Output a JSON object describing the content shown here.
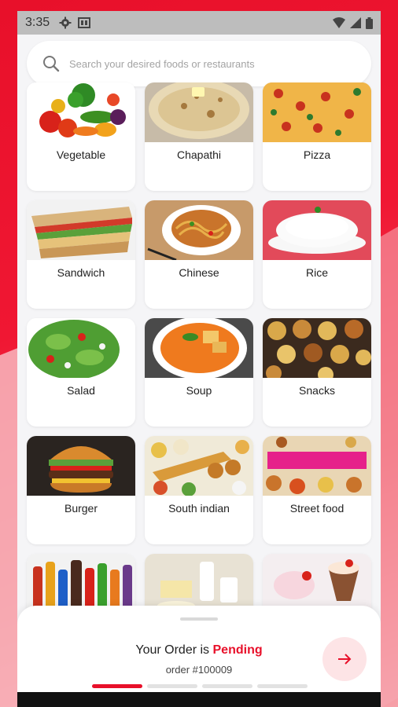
{
  "status_bar": {
    "time": "3:35"
  },
  "search": {
    "placeholder": "Search your desired foods or restaurants"
  },
  "categories": [
    {
      "label": "Vegetable"
    },
    {
      "label": "Chapathi"
    },
    {
      "label": "Pizza"
    },
    {
      "label": "Sandwich"
    },
    {
      "label": "Chinese"
    },
    {
      "label": "Rice"
    },
    {
      "label": "Salad"
    },
    {
      "label": "Soup"
    },
    {
      "label": "Snacks"
    },
    {
      "label": "Burger"
    },
    {
      "label": "South indian"
    },
    {
      "label": "Street food"
    },
    {
      "label": ""
    },
    {
      "label": ""
    },
    {
      "label": ""
    }
  ],
  "order_sheet": {
    "title_prefix": "Your Order is ",
    "status": "Pending",
    "order_number": "order #100009",
    "progress_steps": 4,
    "progress_active": 1
  },
  "colors": {
    "accent": "#e8102a"
  }
}
